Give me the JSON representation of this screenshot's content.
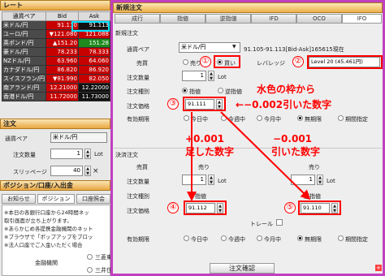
{
  "left": {
    "rate_title": "レート",
    "headers": [
      "通貨ペア",
      "Bid",
      "Ask"
    ],
    "rates": [
      {
        "pair": "米ドル/円",
        "bid": "91.110",
        "ask": "91.113",
        "s": "nc"
      },
      {
        "pair": "ユーロ/円",
        "bid": "▼121.080",
        "ask": "121.088",
        "s": "dn"
      },
      {
        "pair": "英ポンド/円",
        "bid": "▲151.20",
        "ask": "151.28",
        "s": "up"
      },
      {
        "pair": "豪ドル/円",
        "bid": "78.233",
        "ask": "78.333",
        "s": "dn"
      },
      {
        "pair": "NZドル/円",
        "bid": "63.960",
        "ask": "64.060",
        "s": "dn"
      },
      {
        "pair": "カナダドル/円",
        "bid": "86.820",
        "ask": "86.920",
        "s": "dn"
      },
      {
        "pair": "スイスフラン/円",
        "bid": "▼81.990",
        "ask": "82.050",
        "s": "dn"
      },
      {
        "pair": "南アランド/円",
        "bid": "12.21000",
        "ask": "12.22000",
        "s": "nc"
      },
      {
        "pair": "香港ドル/円",
        "bid": "11.72000",
        "ask": "11.73000",
        "s": "nc"
      }
    ],
    "order_title": "注文",
    "pair_label": "通貨ペア",
    "pair_value": "米ドル/円",
    "qty_label": "注文数量",
    "qty_value": "1",
    "lot": "Lot",
    "slip_label": "スリッページ",
    "slip_value": "40",
    "pos_title": "ポジション/口座/入出金",
    "pos_tabs": [
      "お知らせ",
      "ポジション",
      "口座照会"
    ],
    "notice": [
      "※本日の各銀行口座から24時間ネッ",
      "取引画面が立ち上がります。",
      "※あらかじめ各提携金融機関のネット",
      "※ブラウザで「ポップアップをブロッ",
      "※法人口座でご入金いただく場合"
    ],
    "bank_label": "金融機関",
    "banks": [
      "三菱東",
      "三井住"
    ]
  },
  "right": {
    "title": "新規注文",
    "tabs": [
      "成行",
      "指値",
      "逆指値",
      "IFD",
      "OCO",
      "IFO"
    ],
    "subtitle": "新規注文",
    "pair_label": "通貨ペア",
    "pair_value": "米ドル/円",
    "rate_text": "91.105-91.113[Bid-Ask]165615現在",
    "side_label": "売買",
    "sell": "売り",
    "buy": "買い",
    "leverage_label": "レバレッジ",
    "leverage_value": "Level 20 (45.461円)",
    "qty_label": "注文数量",
    "qty_value": "1",
    "lot": "Lot",
    "type_label": "注文種別",
    "limit": "指値",
    "stop": "逆指値",
    "price_label": "注文価格",
    "price_value": "91.111",
    "validity_label": "有効期限",
    "validity": [
      "今日中",
      "今週中",
      "今月中",
      "無期限",
      "期間指定"
    ],
    "settle_title": "決済注文",
    "settle_side_label": "売買",
    "settle_sell_a": "売り",
    "settle_sell_b": "売り",
    "settle_qty_label": "注文数量",
    "settle_qty_a": "1",
    "settle_qty_b": "1",
    "settle_type_label": "注文種別",
    "settle_type_a": "指値",
    "settle_type_b": "逆指値",
    "settle_price_label": "注文価格",
    "settle_price_a": "91.112",
    "settle_price_b": "91.110",
    "trail_label": "トレール",
    "settle_validity_label": "有効期限",
    "confirm": "注文確認"
  },
  "annotations": {
    "n1": "①",
    "n2": "②",
    "n3": "③",
    "n4": "④",
    "n5": "⑤",
    "t1": "水色の枠から",
    "t2": "←−0.002引いた数字",
    "t3a": "+0.001",
    "t3b": "足した数字",
    "t4a": "−0.001",
    "t4b": "引いた数字"
  },
  "colors": {
    "accent": "#ff0000",
    "highlight": "#00e0ff",
    "frame": "#c040c0"
  }
}
